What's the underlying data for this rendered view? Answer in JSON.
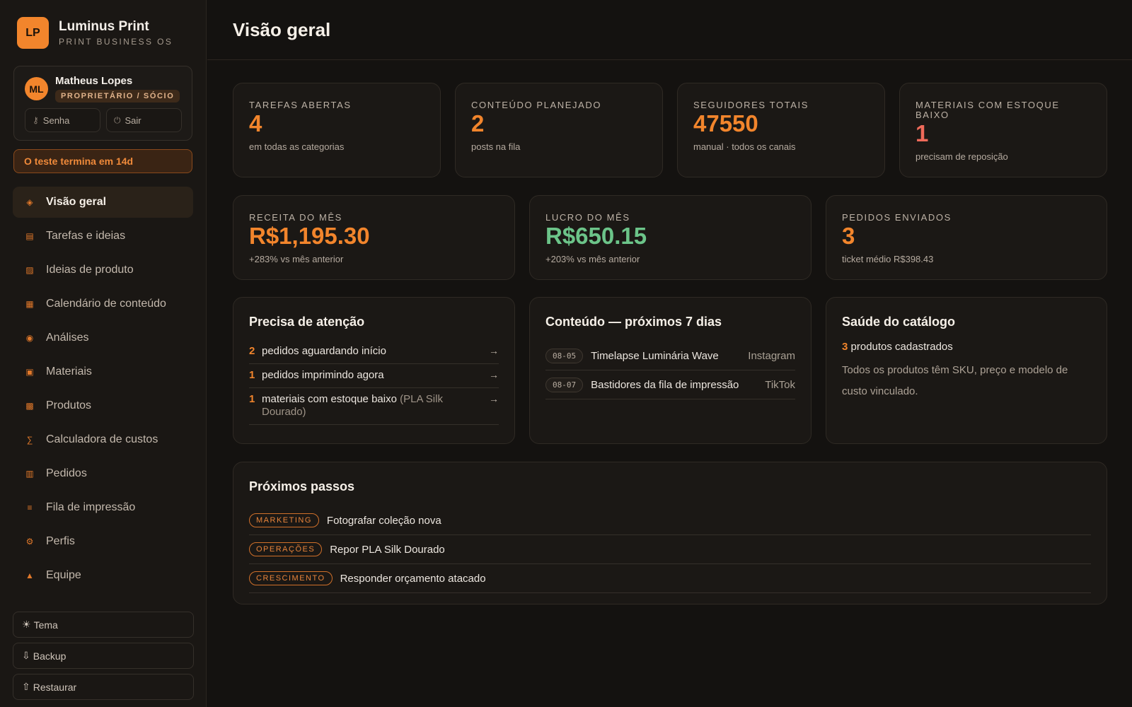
{
  "brand": {
    "logo": "LP",
    "name": "Luminus Print",
    "subtitle": "PRINT BUSINESS OS"
  },
  "user": {
    "initials": "ML",
    "name": "Matheus Lopes",
    "role": "PROPRIETÁRIO / SÓCIO",
    "password_label": "Senha",
    "logout_label": "Sair"
  },
  "trial": {
    "text": "O teste termina em 14d"
  },
  "nav": {
    "items": [
      {
        "label": "Visão geral",
        "icon": "diamond-icon",
        "glyph": "◈",
        "active": true
      },
      {
        "label": "Tarefas e ideias",
        "icon": "tasks-icon",
        "glyph": "▤"
      },
      {
        "label": "Ideias de produto",
        "icon": "ideas-icon",
        "glyph": "▨"
      },
      {
        "label": "Calendário de conteúdo",
        "icon": "calendar-icon",
        "glyph": "▦"
      },
      {
        "label": "Análises",
        "icon": "analytics-icon",
        "glyph": "◉"
      },
      {
        "label": "Materiais",
        "icon": "materials-icon",
        "glyph": "▣"
      },
      {
        "label": "Produtos",
        "icon": "products-icon",
        "glyph": "▩"
      },
      {
        "label": "Calculadora de custos",
        "icon": "sigma-icon",
        "glyph": "∑"
      },
      {
        "label": "Pedidos",
        "icon": "orders-icon",
        "glyph": "▥"
      },
      {
        "label": "Fila de impressão",
        "icon": "queue-icon",
        "glyph": "≡"
      },
      {
        "label": "Perfis",
        "icon": "gear-icon",
        "glyph": "⚙"
      },
      {
        "label": "Equipe",
        "icon": "team-icon",
        "glyph": "▲"
      }
    ]
  },
  "side_actions": {
    "theme": "Tema",
    "backup": "Backup",
    "restore": "Restaurar"
  },
  "header": {
    "title": "Visão geral"
  },
  "stats_row1": [
    {
      "label": "TAREFAS ABERTAS",
      "value": "4",
      "sub": "em todas as categorias",
      "color": "#f2852c"
    },
    {
      "label": "CONTEÚDO PLANEJADO",
      "value": "2",
      "sub": "posts na fila",
      "color": "#f2852c"
    },
    {
      "label": "SEGUIDORES TOTAIS",
      "value": "47550",
      "sub": "manual · todos os canais",
      "color": "#f2852c"
    },
    {
      "label": "MATERIAIS COM ESTOQUE BAIXO",
      "value": "1",
      "sub": "precisam de reposição",
      "color": "#ef6a5a"
    }
  ],
  "stats_row2": [
    {
      "label": "RECEITA DO MÊS",
      "value": "R$1,195.30",
      "sub": "+283% vs mês anterior",
      "color": "#f2852c"
    },
    {
      "label": "LUCRO DO MÊS",
      "value": "R$650.15",
      "sub": "+203% vs mês anterior",
      "color": "#6cc489"
    },
    {
      "label": "PEDIDOS ENVIADOS",
      "value": "3",
      "sub": "ticket médio R$398.43",
      "color": "#f2852c"
    }
  ],
  "attention": {
    "title": "Precisa de atenção",
    "rows": [
      {
        "num": "2",
        "text": "pedidos aguardando início",
        "note": ""
      },
      {
        "num": "1",
        "text": "pedidos imprimindo agora",
        "note": ""
      },
      {
        "num": "1",
        "text": "materiais com estoque baixo",
        "note": "(PLA Silk Dourado)"
      }
    ]
  },
  "content": {
    "title": "Conteúdo — próximos 7 dias",
    "rows": [
      {
        "date": "08-05",
        "title": "Timelapse Luminária Wave",
        "channel": "Instagram"
      },
      {
        "date": "08-07",
        "title": "Bastidores da fila de impressão",
        "channel": "TikTok"
      }
    ]
  },
  "catalog": {
    "title": "Saúde do catálogo",
    "count": "3",
    "count_label": "produtos cadastrados",
    "description": "Todos os produtos têm SKU, preço e modelo de custo vinculado."
  },
  "next_steps": {
    "title": "Próximos passos",
    "rows": [
      {
        "tag": "MARKETING",
        "text": "Fotografar coleção nova"
      },
      {
        "tag": "OPERAÇÕES",
        "text": "Repor PLA Silk Dourado"
      },
      {
        "tag": "CRESCIMENTO",
        "text": "Responder orçamento atacado"
      }
    ]
  }
}
